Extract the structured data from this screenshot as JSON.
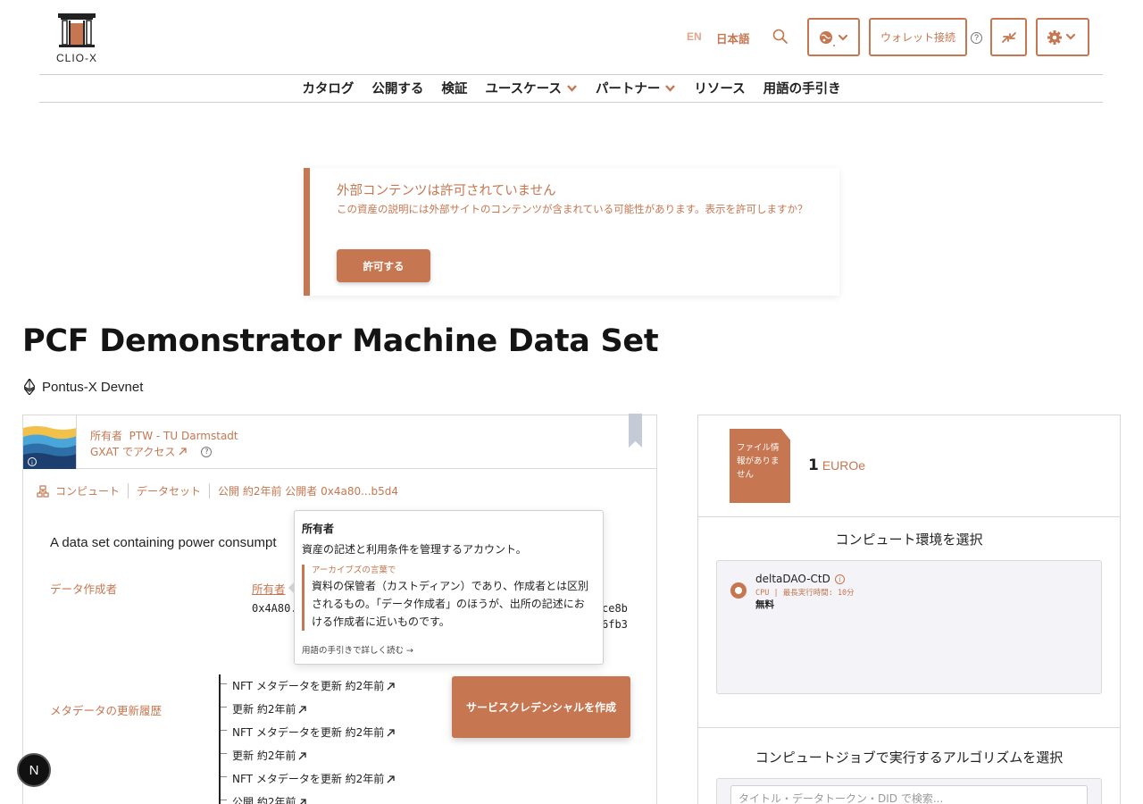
{
  "header": {
    "logo_text": "CLIO-X",
    "lang_en": "EN",
    "lang_ja": "日本語",
    "wallet_label": "ウォレット接続",
    "help_mark": "?"
  },
  "nav": {
    "items": [
      {
        "label": "カタログ"
      },
      {
        "label": "公開する"
      },
      {
        "label": "検証"
      },
      {
        "label": "ユースケース"
      },
      {
        "label": "パートナー"
      },
      {
        "label": "リソース"
      },
      {
        "label": "用語の手引き"
      }
    ]
  },
  "alert": {
    "title": "外部コンテンツは許可されていません",
    "text": "この資産の説明には外部サイトのコンテンツが含まれている可能性があります。表示を許可しますか？",
    "button": "許可する"
  },
  "asset": {
    "title": "PCF Demonstrator Machine Data Set",
    "network": "Pontus-X Devnet",
    "owner_prefix": "所有者",
    "owner_name": "PTW - TU Darmstadt",
    "access": "GXAT でアクセス",
    "meta": [
      "コンピュート",
      "データセット",
      "公開 約2年前 公開者 0x4a80...b5d4"
    ],
    "description": "A data set containing power consumpt",
    "creator_label": "データ作成者",
    "owner_link": "所有者",
    "addr_frag": "0x4A80.",
    "addr_end1": "ce8b",
    "addr_end2": "6fb3",
    "history_label": "メタデータの更新履歴",
    "history": [
      "NFT メタデータを更新 約2年前",
      "更新 約2年前",
      "NFT メタデータを更新 約2年前",
      "更新 約2年前",
      "NFT メタデータを更新 約2年前",
      "公開 約2年前"
    ],
    "cred_button": "サービスクレデンシャルを作成"
  },
  "tooltip": {
    "title": "所有者",
    "definition": "資産の記述と利用条件を管理するアカウント。",
    "quote_label": "アーカイブズの言葉で",
    "quote_text": "資料の保管者（カストディアン）であり、作成者とは区別されるもの。「データ作成者」のほうが、出所の記述における作成者に近いものです。",
    "more": "用語の手引きで詳しく読む →"
  },
  "pricing": {
    "file_tile": "ファイル情報がありません",
    "price": "1",
    "currency": "EUROe"
  },
  "compute": {
    "env_title": "コンピュート環境を選択",
    "env_name": "deltaDAO-CtD",
    "env_spec": "CPU | 最長実行時間: 10分",
    "env_price": "無料",
    "algo_title": "コンピュートジョブで実行するアルゴリズムを選択",
    "algo_placeholder": "タイトル・データトークン・DID で検索..."
  },
  "badge": "N",
  "colors": {
    "accent": "#c67650",
    "text": "#222222"
  }
}
